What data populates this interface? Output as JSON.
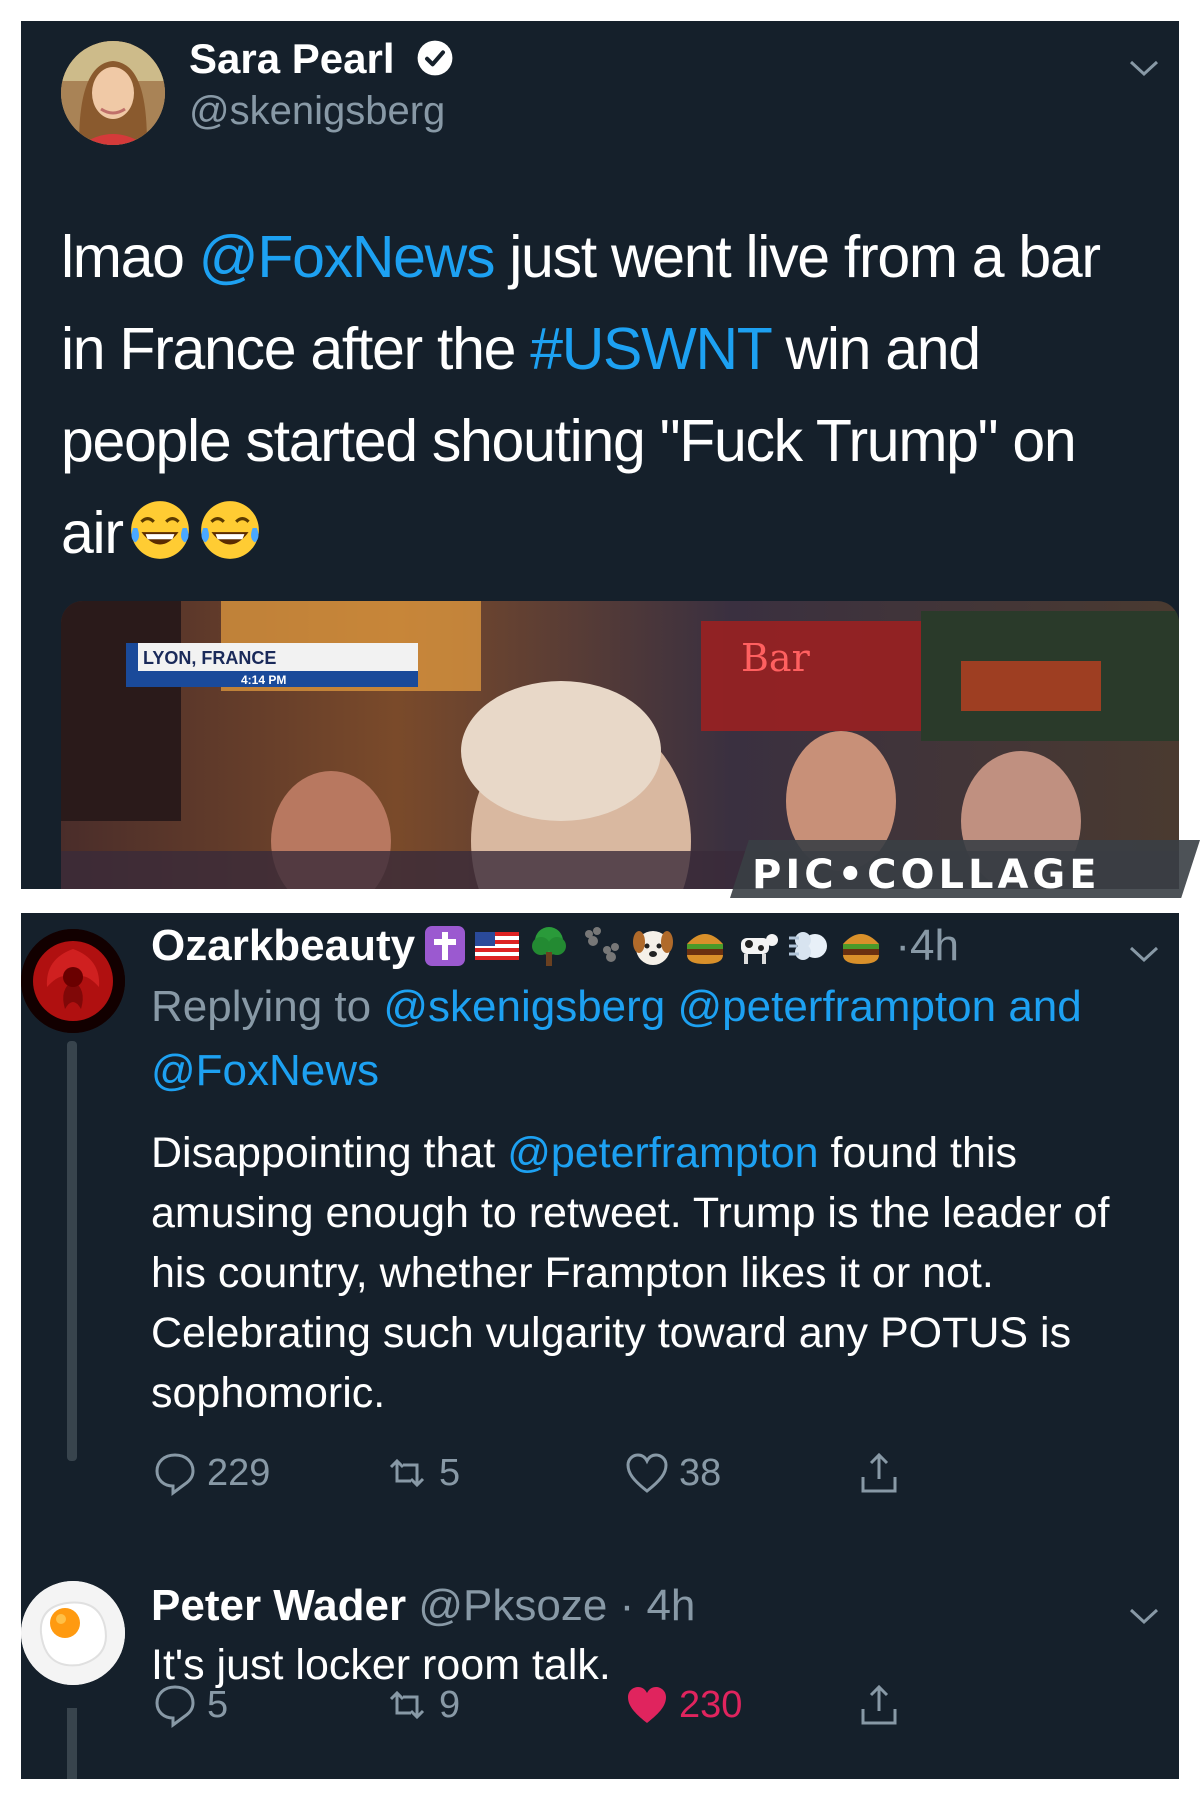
{
  "tweet": {
    "author_name": "Sara Pearl",
    "author_handle": "@skenigsberg",
    "text_parts": [
      {
        "text": "lmao ",
        "style": "plain"
      },
      {
        "text": "@FoxNews",
        "style": "link"
      },
      {
        "text": " just went live from a bar in France after the ",
        "style": "plain"
      },
      {
        "text": "#USWNT",
        "style": "link"
      },
      {
        "text": " win and people started shouting \"Fuck Trump\" on air",
        "style": "plain"
      }
    ],
    "emoji": [
      "face-with-tears-of-joy",
      "face-with-tears-of-joy"
    ],
    "media": {
      "chyron_line1": "LYON, FRANCE",
      "chyron_line2": "4:14 PM",
      "sign": "Bar"
    }
  },
  "reply1": {
    "author_name": "Ozarkbeauty",
    "name_emoji": [
      "latin-cross",
      "us-flag",
      "tree",
      "paw-prints",
      "dog-face",
      "hamburger",
      "cow",
      "dash",
      "hamburger"
    ],
    "time": "4h",
    "replying_prefix": "Replying to ",
    "replying_to": "@skenigsberg @peterframpton and @FoxNews",
    "body_before": "Disappointing that ",
    "body_mention": "@peterframpton",
    "body_after": " found this amusing enough to retweet. Trump is the leader of his country, whether Frampton likes it or not. Celebrating such vulgarity toward any POTUS is sophomoric.",
    "replies": "229",
    "retweets": "5",
    "likes": "38"
  },
  "reply2": {
    "author_name": "Peter Wader",
    "author_handle": "@Pksoze",
    "time": "4h",
    "body": "It's just locker room talk.",
    "replies": "5",
    "retweets": "9",
    "likes": "230",
    "liked": true
  },
  "watermark": "PIC•COLLAGE",
  "colors": {
    "background": "#15202b",
    "link": "#1da1f2",
    "muted": "#8899a6",
    "like": "#e0245e"
  }
}
